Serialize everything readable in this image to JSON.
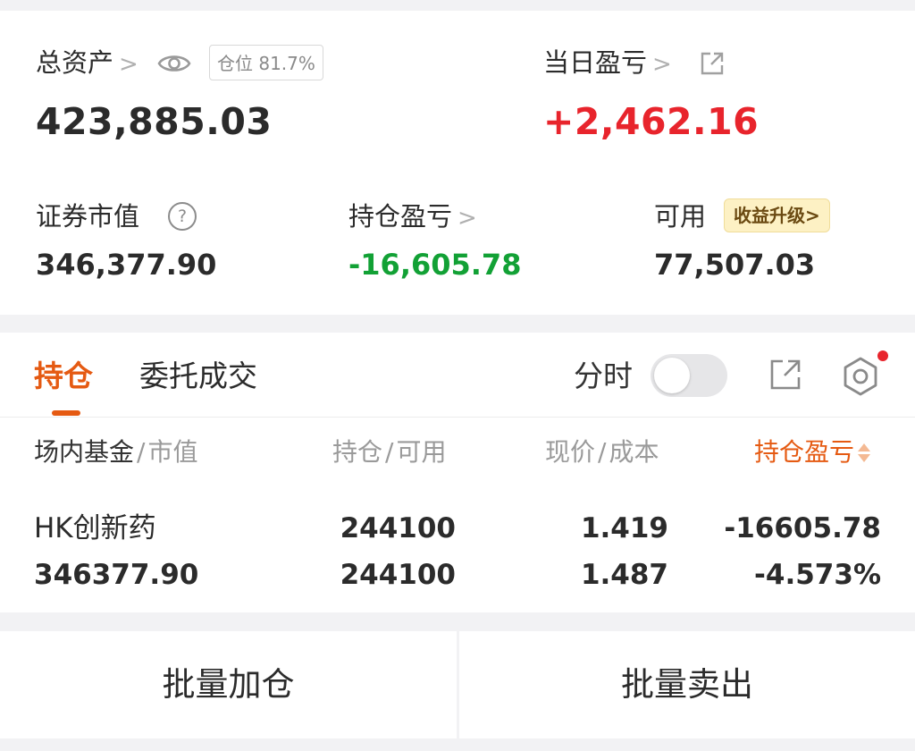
{
  "summary": {
    "total_assets_label": "总资产",
    "total_assets_value": "423,885.03",
    "position_ratio": "仓位 81.7%",
    "daily_pnl_label": "当日盈亏",
    "daily_pnl_value": "+2,462.16",
    "market_value_label": "证券市值",
    "market_value_value": "346,377.90",
    "holding_pnl_label": "持仓盈亏",
    "holding_pnl_value": "-16,605.78",
    "available_label": "可用",
    "available_value": "77,507.03",
    "upgrade_badge": "收益升级>"
  },
  "tabs": {
    "holdings": "持仓",
    "orders": "委托成交",
    "timeshare_label": "分时"
  },
  "table": {
    "headers": {
      "name": "场内基金",
      "name_sub": "市值",
      "qty": "持仓",
      "qty_sub": "可用",
      "price": "现价",
      "price_sub": "成本",
      "pnl": "持仓盈亏",
      "sep": "/"
    },
    "rows": [
      {
        "name": "HK创新药",
        "market_value": "346377.90",
        "holding": "244100",
        "available": "244100",
        "current_price": "1.419",
        "cost": "1.487",
        "pnl": "-16605.78",
        "pnl_pct": "-4.573%"
      }
    ]
  },
  "actions": {
    "batch_add": "批量加仓",
    "batch_sell": "批量卖出"
  },
  "colors": {
    "accent": "#e55a12",
    "gain": "#e8242c",
    "loss": "#12a135"
  },
  "icons": {
    "eye": "eye-icon",
    "external": "external-link-icon",
    "question": "question-icon",
    "settings": "gear-icon"
  }
}
